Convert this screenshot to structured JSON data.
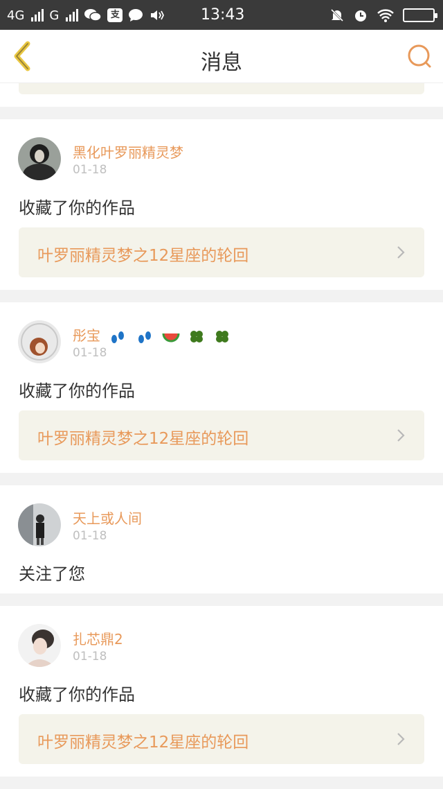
{
  "status_bar": {
    "net1": "4G",
    "net2": "G",
    "app_icon": "支",
    "time": "13:43"
  },
  "header": {
    "title": "消息",
    "back_icon": "chevron-left-icon",
    "search_icon": "search-icon"
  },
  "colors": {
    "accent": "#e8995a",
    "card_bg": "#f4f3ea",
    "statusbar": "#3a3a3a"
  },
  "notifications": [
    {
      "user": "黑化叶罗丽精灵梦",
      "date": "01-18",
      "action": "收藏了你的作品",
      "work_title": "叶罗丽精灵梦之12星座的轮回"
    },
    {
      "user": "彤宝",
      "date": "01-18",
      "action": "收藏了你的作品",
      "work_title": "叶罗丽精灵梦之12星座的轮回"
    },
    {
      "user": "天上或人间",
      "date": "01-18",
      "action": "关注了您"
    },
    {
      "user": "扎芯鼎2",
      "date": "01-18",
      "action": "收藏了你的作品",
      "work_title": "叶罗丽精灵梦之12星座的轮回"
    }
  ]
}
